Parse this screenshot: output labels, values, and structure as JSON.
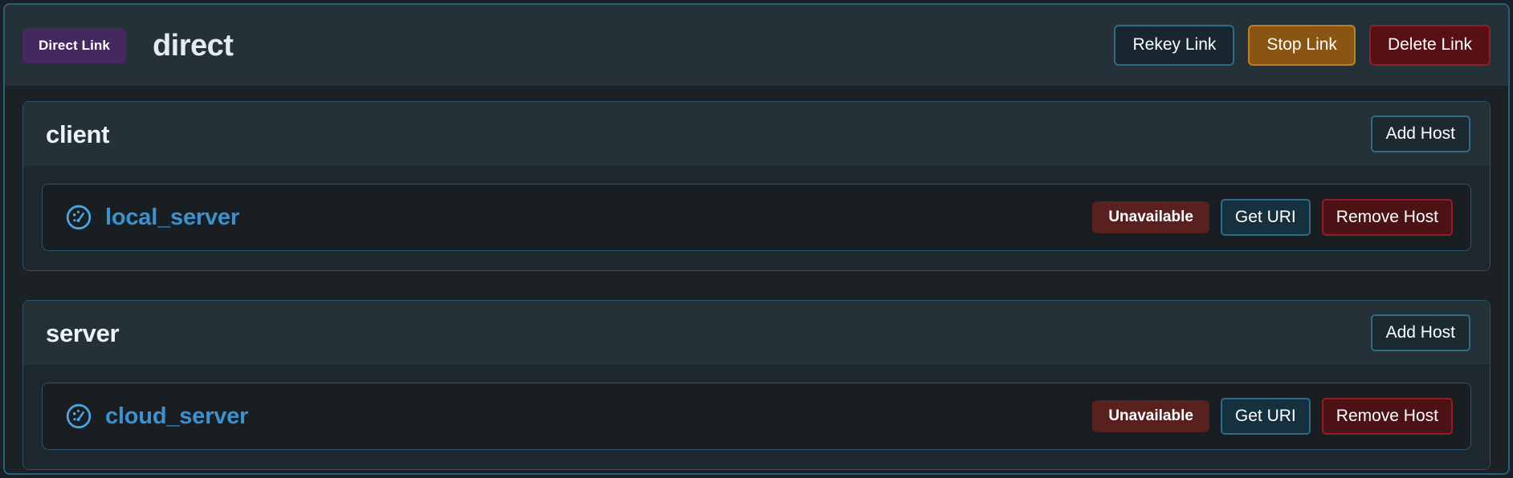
{
  "header": {
    "badge_label": "Direct Link",
    "title": "direct",
    "actions": [
      {
        "label": "Rekey Link",
        "style": "outline-blue",
        "name": "rekey-link-button"
      },
      {
        "label": "Stop Link",
        "style": "warn",
        "name": "stop-link-button"
      },
      {
        "label": "Delete Link",
        "style": "danger",
        "name": "delete-link-button"
      }
    ]
  },
  "groups": [
    {
      "title": "client",
      "add_host_label": "Add Host",
      "hosts": [
        {
          "name": "local_server",
          "icon": "gauge-icon",
          "status": "Unavailable",
          "get_uri_label": "Get URI",
          "remove_label": "Remove Host"
        }
      ]
    },
    {
      "title": "server",
      "add_host_label": "Add Host",
      "hosts": [
        {
          "name": "cloud_server",
          "icon": "gauge-icon",
          "status": "Unavailable",
          "get_uri_label": "Get URI",
          "remove_label": "Remove Host"
        }
      ]
    }
  ],
  "colors": {
    "accent_blue": "#3b92cf",
    "border_teal": "#2b5f78",
    "badge_purple": "#45285e",
    "status_red": "#58201f",
    "warn_amber": "#8a5512",
    "danger_red": "#571115",
    "header_bg": "#243138",
    "body_bg": "#1b2125",
    "row_bg": "#181e22"
  }
}
